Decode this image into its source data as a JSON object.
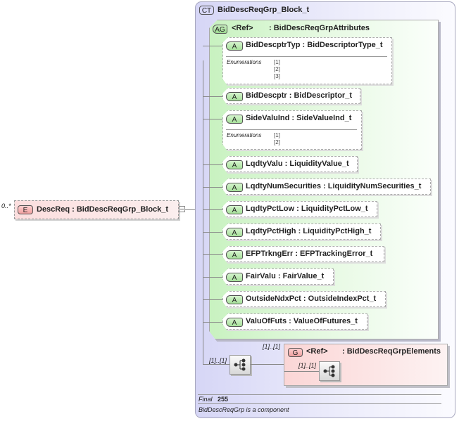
{
  "element": {
    "cardinality": "0..*",
    "badge": "E",
    "name": "DescReq",
    "type": ": BidDescReqGrp_Block_t"
  },
  "complex_type": {
    "badge": "CT",
    "name": "BidDescReqGrp_Block_t"
  },
  "attribute_group": {
    "badge": "AG",
    "ref": "<Ref>",
    "name": ": BidDescReqGrpAttributes"
  },
  "attributes": [
    {
      "badge": "A",
      "name": "BidDescptrTyp",
      "type": ": BidDescriptorType_t",
      "enumerations_label": "Enumerations",
      "enumerations": [
        "[1]",
        "[2]",
        "[3]"
      ]
    },
    {
      "badge": "A",
      "name": "BidDescptr",
      "type": ": BidDescriptor_t"
    },
    {
      "badge": "A",
      "name": "SideValuInd",
      "type": ": SideValueInd_t",
      "enumerations_label": "Enumerations",
      "enumerations": [
        "[1]",
        "[2]"
      ]
    },
    {
      "badge": "A",
      "name": "LqdtyValu",
      "type": ": LiquidityValue_t"
    },
    {
      "badge": "A",
      "name": "LqdtyNumSecurities",
      "type": ": LiquidityNumSecurities_t"
    },
    {
      "badge": "A",
      "name": "LqdtyPctLow",
      "type": ": LiquidityPctLow_t"
    },
    {
      "badge": "A",
      "name": "LqdtyPctHigh",
      "type": ": LiquidityPctHigh_t"
    },
    {
      "badge": "A",
      "name": "EFPTrkngErr",
      "type": ": EFPTrackingError_t"
    },
    {
      "badge": "A",
      "name": "FairValu",
      "type": ": FairValue_t"
    },
    {
      "badge": "A",
      "name": "OutsideNdxPct",
      "type": ": OutsideIndexPct_t"
    },
    {
      "badge": "A",
      "name": "ValuOfFuts",
      "type": ": ValueOfFutures_t"
    }
  ],
  "sequence": {
    "cardinality": "[1]..[1]"
  },
  "group": {
    "cardinality": "[1]..[1]",
    "badge": "G",
    "ref": "<Ref>",
    "name": ": BidDescReqGrpElements",
    "inner_sequence_cardinality": "[1]..[1]"
  },
  "footer": {
    "final_label": "Final",
    "final_value": "255",
    "note": "BidDescReqGrp is a component"
  }
}
